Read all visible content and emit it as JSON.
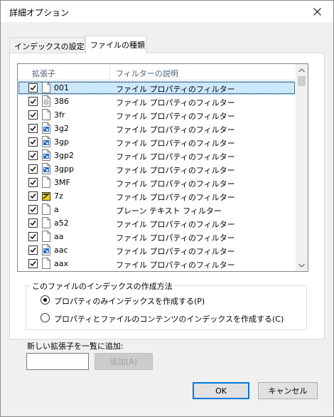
{
  "window": {
    "title": "詳細オプション"
  },
  "tabs": [
    {
      "label": "インデックスの設定",
      "active": false
    },
    {
      "label": "ファイルの種類",
      "active": true
    }
  ],
  "list": {
    "columns": [
      "拡張子",
      "フィルターの説明"
    ],
    "rows": [
      {
        "ext": "001",
        "desc": "ファイル プロパティのフィルター",
        "checked": true,
        "selected": true,
        "icon": "blank-file-icon"
      },
      {
        "ext": "386",
        "desc": "ファイル プロパティのフィルター",
        "checked": true,
        "selected": false,
        "icon": "system-file-icon"
      },
      {
        "ext": "3fr",
        "desc": "ファイル プロパティのフィルター",
        "checked": true,
        "selected": false,
        "icon": "blank-file-icon"
      },
      {
        "ext": "3g2",
        "desc": "ファイル プロパティのフィルター",
        "checked": true,
        "selected": false,
        "icon": "video-file-icon"
      },
      {
        "ext": "3gp",
        "desc": "ファイル プロパティのフィルター",
        "checked": true,
        "selected": false,
        "icon": "video-file-icon"
      },
      {
        "ext": "3gp2",
        "desc": "ファイル プロパティのフィルター",
        "checked": true,
        "selected": false,
        "icon": "video-file-icon"
      },
      {
        "ext": "3gpp",
        "desc": "ファイル プロパティのフィルター",
        "checked": true,
        "selected": false,
        "icon": "video-file-icon"
      },
      {
        "ext": "3MF",
        "desc": "ファイル プロパティのフィルター",
        "checked": true,
        "selected": false,
        "icon": "blank-file-icon"
      },
      {
        "ext": "7z",
        "desc": "ファイル プロパティのフィルター",
        "checked": true,
        "selected": false,
        "icon": "archive-file-icon"
      },
      {
        "ext": "a",
        "desc": "プレーン テキスト フィルター",
        "checked": true,
        "selected": false,
        "icon": "blank-file-icon"
      },
      {
        "ext": "a52",
        "desc": "ファイル プロパティのフィルター",
        "checked": true,
        "selected": false,
        "icon": "blank-file-icon"
      },
      {
        "ext": "aa",
        "desc": "ファイル プロパティのフィルター",
        "checked": true,
        "selected": false,
        "icon": "blank-file-icon"
      },
      {
        "ext": "aac",
        "desc": "ファイル プロパティのフィルター",
        "checked": true,
        "selected": false,
        "icon": "video-file-icon"
      },
      {
        "ext": "aax",
        "desc": "ファイル プロパティのフィルター",
        "checked": true,
        "selected": false,
        "icon": "blank-file-icon"
      }
    ]
  },
  "index_method": {
    "title": "このファイルのインデックスの作成方法",
    "options": [
      {
        "label": "プロパティのみインデックスを作成する(P)",
        "selected": true
      },
      {
        "label": "プロパティとファイルのコンテンツのインデックスを作成する(C)",
        "selected": false
      }
    ]
  },
  "add_extension": {
    "label": "新しい拡張子を一覧に追加:",
    "value": "",
    "button": "追加(A)"
  },
  "buttons": {
    "ok": "OK",
    "cancel": "キャンセル"
  },
  "colors": {
    "selection": "#cce8ff",
    "accent": "#0078d7",
    "header_text": "#4c607a"
  }
}
